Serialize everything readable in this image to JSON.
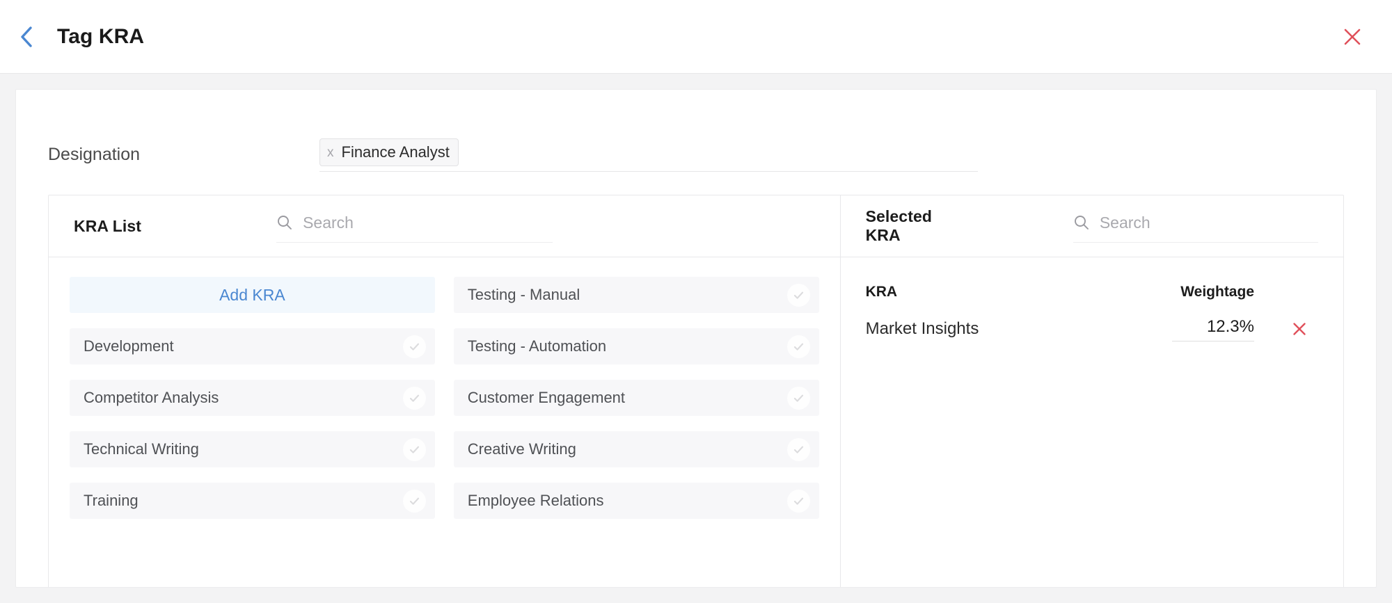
{
  "header": {
    "title": "Tag KRA",
    "back_icon": "chevron-left-icon",
    "close_icon": "close-icon",
    "accent_blue": "#4a87d1",
    "close_red": "#e0505a"
  },
  "designation": {
    "label": "Designation",
    "chips": [
      {
        "remove_glyph": "x",
        "label": "Finance Analyst"
      }
    ]
  },
  "kra_list": {
    "title": "KRA List",
    "search": {
      "icon": "search-icon",
      "placeholder": "Search",
      "value": ""
    },
    "add_button": {
      "label": "Add KRA"
    },
    "items": [
      {
        "label": "Testing - Manual",
        "icon": "check-circle-icon"
      },
      {
        "label": "Development",
        "icon": "check-circle-icon"
      },
      {
        "label": "Testing - Automation",
        "icon": "check-circle-icon"
      },
      {
        "label": "Competitor Analysis",
        "icon": "check-circle-icon"
      },
      {
        "label": "Customer Engagement",
        "icon": "check-circle-icon"
      },
      {
        "label": "Technical Writing",
        "icon": "check-circle-icon"
      },
      {
        "label": "Creative Writing",
        "icon": "check-circle-icon"
      },
      {
        "label": "Training",
        "icon": "check-circle-icon"
      },
      {
        "label": "Employee Relations",
        "icon": "check-circle-icon"
      }
    ]
  },
  "selected_kra": {
    "title": "Selected KRA",
    "search": {
      "icon": "search-icon",
      "placeholder": "Search",
      "value": ""
    },
    "columns": {
      "kra": "KRA",
      "weightage": "Weightage"
    },
    "rows": [
      {
        "kra": "Market Insights",
        "weightage": "12.3%",
        "remove_icon": "close-icon"
      }
    ]
  }
}
